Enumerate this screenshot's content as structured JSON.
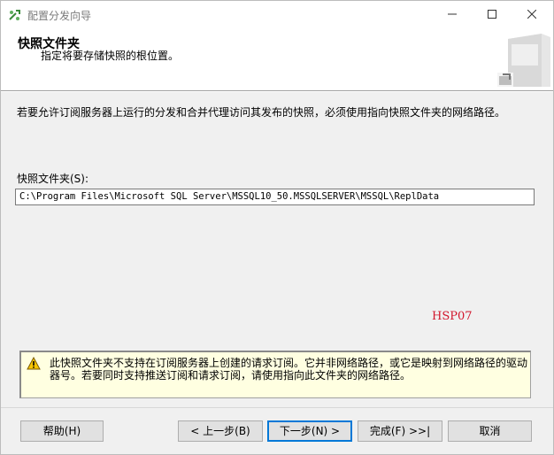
{
  "window": {
    "title": "配置分发向导"
  },
  "header": {
    "title": "快照文件夹",
    "subtitle": "指定将要存储快照的根位置。"
  },
  "main": {
    "description": "若要允许订阅服务器上运行的分发和合并代理访问其发布的快照，必须使用指向快照文件夹的网络路径。",
    "folder_label": "快照文件夹(S):",
    "folder_value": "C:\\Program Files\\Microsoft SQL Server\\MSSQL10_50.MSSQLSERVER\\MSSQL\\ReplData",
    "stamp_text": "HSP07"
  },
  "warning": {
    "icon": "warning-icon",
    "text": "此快照文件夹不支持在订阅服务器上创建的请求订阅。它并非网络路径，或它是映射到网络路径的驱动器号。若要同时支持推送订阅和请求订阅，请使用指向此文件夹的网络路径。"
  },
  "buttons": {
    "help": "帮助(H)",
    "back": "< 上一步(B)",
    "next": "下一步(N) >",
    "finish": "完成(F) >>|",
    "cancel": "取消"
  },
  "colors": {
    "accent": "#0078d7",
    "warning_bg": "#ffffe1",
    "stamp": "#d2162c"
  }
}
